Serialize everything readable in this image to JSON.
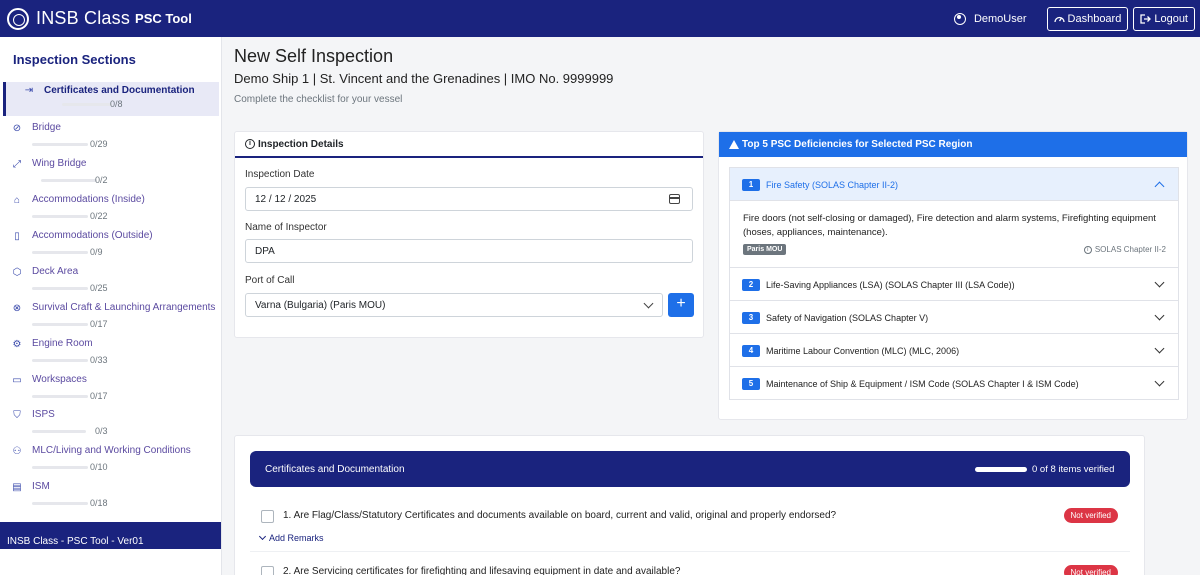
{
  "navbar": {
    "brand": "INSB Class",
    "brand_sub": "PSC Tool",
    "user": "DemoUser",
    "dashboard_label": "Dashboard",
    "logout_label": "Logout"
  },
  "sidebar": {
    "title": "Inspection Sections",
    "items": [
      {
        "label": "Certificates and Documentation",
        "count": "0/8",
        "icon": "file-import-icon"
      },
      {
        "label": "Bridge",
        "count": "0/29",
        "icon": "compass-icon"
      },
      {
        "label": "Wing Bridge",
        "count": "0/2",
        "icon": "expand-icon"
      },
      {
        "label": "Accommodations (Inside)",
        "count": "0/22",
        "icon": "house-icon"
      },
      {
        "label": "Accommodations (Outside)",
        "count": "0/9",
        "icon": "building-icon"
      },
      {
        "label": "Deck Area",
        "count": "0/25",
        "icon": "box-icon"
      },
      {
        "label": "Survival Craft & Launching Arrangements",
        "count": "0/17",
        "icon": "life-ring-icon"
      },
      {
        "label": "Engine Room",
        "count": "0/33",
        "icon": "gear-icon"
      },
      {
        "label": "Workspaces",
        "count": "0/17",
        "icon": "briefcase-icon"
      },
      {
        "label": "ISPS",
        "count": "0/3",
        "icon": "shield-icon"
      },
      {
        "label": "MLC/Living and Working Conditions",
        "count": "0/10",
        "icon": "people-icon"
      },
      {
        "label": "ISM",
        "count": "0/18",
        "icon": "clipboard-icon"
      }
    ],
    "footer": "INSB Class - PSC Tool - Ver01"
  },
  "main": {
    "title": "New Self Inspection",
    "ship_line": "Demo Ship 1 | St. Vincent and the Grenadines | IMO No. 9999999",
    "subtitle": "Complete the checklist for your vessel"
  },
  "details": {
    "header": "Inspection Details",
    "date_label": "Inspection Date",
    "date_value": "12 / 12 / 2025",
    "inspector_label": "Name of Inspector",
    "inspector_value": "DPA",
    "port_label": "Port of Call",
    "port_value": "Varna (Bulgaria) (Paris MOU)",
    "add_label": "+"
  },
  "psc": {
    "header": "Top 5 PSC Deficiencies for Selected PSC Region",
    "items": [
      {
        "num": "1",
        "title": "Fire Safety (SOLAS Chapter II-2)"
      },
      {
        "num": "2",
        "title": "Life-Saving Appliances (LSA) (SOLAS Chapter III (LSA Code))"
      },
      {
        "num": "3",
        "title": "Safety of Navigation (SOLAS Chapter V)"
      },
      {
        "num": "4",
        "title": "Maritime Labour Convention (MLC) (MLC, 2006)"
      },
      {
        "num": "5",
        "title": "Maintenance of Ship & Equipment / ISM Code (SOLAS Chapter I & ISM Code)"
      }
    ],
    "open_desc": "Fire doors (not self-closing or damaged), Fire detection and alarm systems, Firefighting equipment (hoses, appliances, maintenance).",
    "open_badge": "Paris MOU",
    "open_ref": "SOLAS Chapter II-2"
  },
  "checklist": {
    "title": "Certificates and Documentation",
    "verified": "0 of 8 items verified",
    "remarks_label": "Add Remarks",
    "questions": [
      {
        "text": "1. Are Flag/Class/Statutory Certificates and documents available on board, current and valid, original and properly endorsed?",
        "status": "Not verified"
      },
      {
        "text": "2. Are Servicing certificates for firefighting and lifesaving equipment in date and available?",
        "status": "Not verified"
      }
    ]
  },
  "colors": {
    "navy": "#1a237e",
    "primary": "#1e6fe8",
    "danger": "#dc3545"
  }
}
